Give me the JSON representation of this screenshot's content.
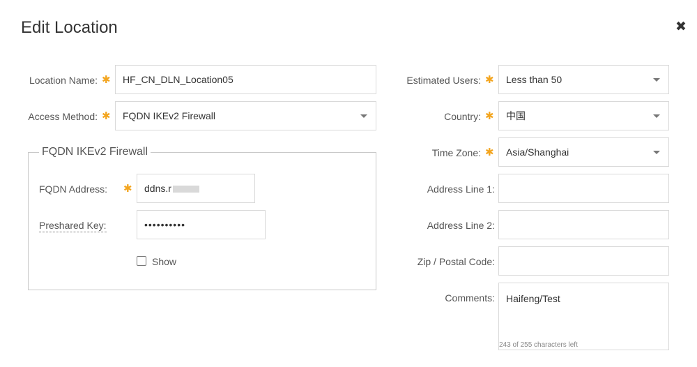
{
  "dialog": {
    "title": "Edit Location",
    "close_icon": "close-icon"
  },
  "left": {
    "location_name_label": "Location Name:",
    "location_name_value": "HF_CN_DLN_Location05",
    "access_method_label": "Access Method:",
    "access_method_value": "FQDN IKEv2 Firewall",
    "group_title": "FQDN IKEv2 Firewall",
    "fqdn_label": "FQDN Address:",
    "fqdn_value": "ddns.r",
    "psk_label": "Preshared Key:",
    "psk_value": "••••••••••",
    "show_label": "Show"
  },
  "right": {
    "users_label": "Estimated Users:",
    "users_value": "Less than 50",
    "country_label": "Country:",
    "country_value": "中国",
    "tz_label": "Time Zone:",
    "tz_value": "Asia/Shanghai",
    "addr1_label": "Address Line 1:",
    "addr1_value": "",
    "addr2_label": "Address Line 2:",
    "addr2_value": "",
    "zip_label": "Zip / Postal Code:",
    "zip_value": "",
    "comments_label": "Comments:",
    "comments_value": "Haifeng/Test",
    "comments_counter": "243 of 255 characters left"
  },
  "required_marker": "✱",
  "colors": {
    "required": "#f3a51f",
    "border": "#d9d9d9",
    "text": "#333333"
  }
}
